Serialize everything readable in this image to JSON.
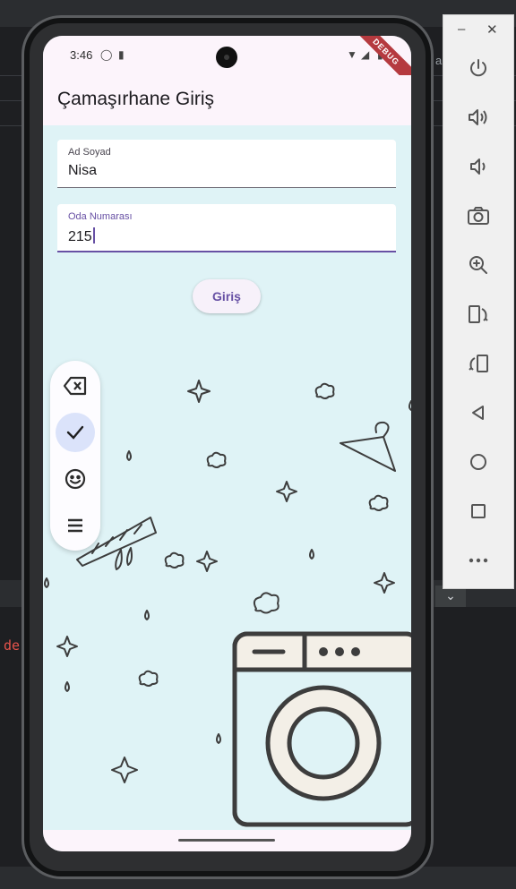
{
  "status_bar": {
    "time": "3:46",
    "debug_banner": "DEBUG"
  },
  "app_bar": {
    "title": "Çamaşırhane Giriş"
  },
  "form": {
    "name_label": "Ad Soyad",
    "name_value": "Nisa",
    "room_label": "Oda Numarası",
    "room_value": "215",
    "submit_label": "Giriş"
  },
  "keyboard_toolbar": {
    "buttons": [
      "backspace-icon",
      "check-icon",
      "emoji-icon",
      "menu-icon"
    ],
    "active": "check-icon"
  },
  "emulator_controls": {
    "window": [
      "minimize-icon",
      "close-icon"
    ],
    "buttons": [
      "power-icon",
      "volume-up-icon",
      "volume-down-icon",
      "camera-icon",
      "zoom-icon",
      "rotate-left-icon",
      "rotate-right-icon",
      "back-icon",
      "home-icon",
      "overview-icon",
      "more-icon"
    ]
  },
  "ide_background": {
    "error_fragment": "de",
    "letter_fragment": "a"
  },
  "colors": {
    "accent": "#6750a4",
    "background": "#dff3f6",
    "appbar": "#fcf4fb",
    "debug": "#b53a3f"
  }
}
